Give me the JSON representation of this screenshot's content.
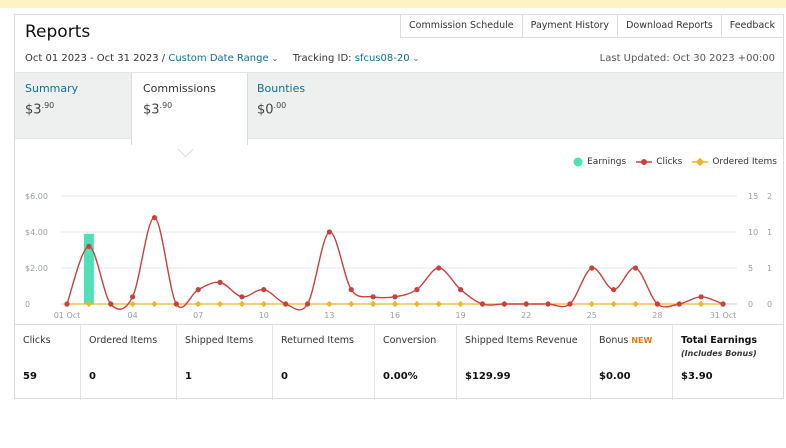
{
  "title": "Reports",
  "top_links": [
    "Commission Schedule",
    "Payment History",
    "Download Reports",
    "Feedback"
  ],
  "filters": {
    "date_range": "Oct 01 2023 - Oct 31 2023",
    "separator": "/",
    "custom_range": "Custom Date Range",
    "tracking_label": "Tracking ID:",
    "tracking_id": "sfcus08-20"
  },
  "last_updated": "Last Updated: Oct 30 2023 +00:00",
  "tabs": [
    {
      "label": "Summary",
      "value_main": "$3",
      "value_cents": ".90"
    },
    {
      "label": "Commissions",
      "value_main": "$3",
      "value_cents": ".90"
    },
    {
      "label": "Bounties",
      "value_main": "$0",
      "value_cents": ".00"
    }
  ],
  "legend": [
    "Earnings",
    "Clicks",
    "Ordered Items"
  ],
  "colors": {
    "earnings": "#4fe0b6",
    "clicks": "#c9413f",
    "ordered": "#f0b429",
    "link": "#0b6f9c",
    "new_badge": "#e47911"
  },
  "chart_data": {
    "type": "line",
    "x": [
      "01 Oct",
      "02",
      "03",
      "04",
      "05",
      "06",
      "07",
      "08",
      "09",
      "10",
      "11",
      "12",
      "13",
      "14",
      "15",
      "16",
      "17",
      "18",
      "19",
      "20",
      "21",
      "22",
      "23",
      "24",
      "25",
      "26",
      "27",
      "28",
      "29",
      "30",
      "31 Oct"
    ],
    "x_tick_labels": [
      "01 Oct",
      "04",
      "07",
      "10",
      "13",
      "16",
      "19",
      "22",
      "25",
      "28",
      "31 Oct"
    ],
    "y_left_ticks": [
      "0",
      "$2.00",
      "$4.00",
      "$6.00"
    ],
    "y_left_range": [
      0,
      6
    ],
    "y_right1_ticks": [
      "0",
      "5",
      "10",
      "15"
    ],
    "y_right1_range": [
      0,
      15
    ],
    "y_right2_ticks": [
      "0",
      "1",
      "1",
      "2"
    ],
    "y_right2_range": [
      0,
      2
    ],
    "series": [
      {
        "name": "Earnings",
        "kind": "bar",
        "axis": "left",
        "values": [
          0,
          3.9,
          0,
          0,
          0,
          0,
          0,
          0,
          0,
          0,
          0,
          0,
          0,
          0,
          0,
          0,
          0,
          0,
          0,
          0,
          0,
          0,
          0,
          0,
          0,
          0,
          0,
          0,
          0,
          0,
          0
        ]
      },
      {
        "name": "Clicks",
        "kind": "line",
        "axis": "right1",
        "values": [
          0,
          8,
          0,
          1,
          12,
          0,
          2,
          3,
          1,
          2,
          0,
          0,
          10,
          2,
          1,
          1,
          2,
          5,
          2,
          0,
          0,
          0,
          0,
          0,
          5,
          2,
          5,
          0,
          0,
          1,
          0
        ]
      },
      {
        "name": "Ordered Items",
        "kind": "line",
        "axis": "right2",
        "values": [
          0,
          0,
          0,
          0,
          0,
          0,
          0,
          0,
          0,
          0,
          0,
          0,
          0,
          0,
          0,
          0,
          0,
          0,
          0,
          0,
          0,
          0,
          0,
          0,
          0,
          0,
          0,
          0,
          0,
          0,
          0
        ]
      }
    ]
  },
  "stats": [
    {
      "label": "Clicks",
      "value": "59"
    },
    {
      "label": "Ordered Items",
      "value": "0"
    },
    {
      "label": "Shipped Items",
      "value": "1"
    },
    {
      "label": "Returned Items",
      "value": "0"
    },
    {
      "label": "Conversion",
      "value": "0.00%"
    },
    {
      "label": "Shipped Items Revenue",
      "value": "$129.99"
    },
    {
      "label": "Bonus",
      "badge": "NEW",
      "value": "$0.00"
    },
    {
      "label": "Total Earnings",
      "sublabel": "(Includes Bonus)",
      "value": "$3.90"
    }
  ]
}
